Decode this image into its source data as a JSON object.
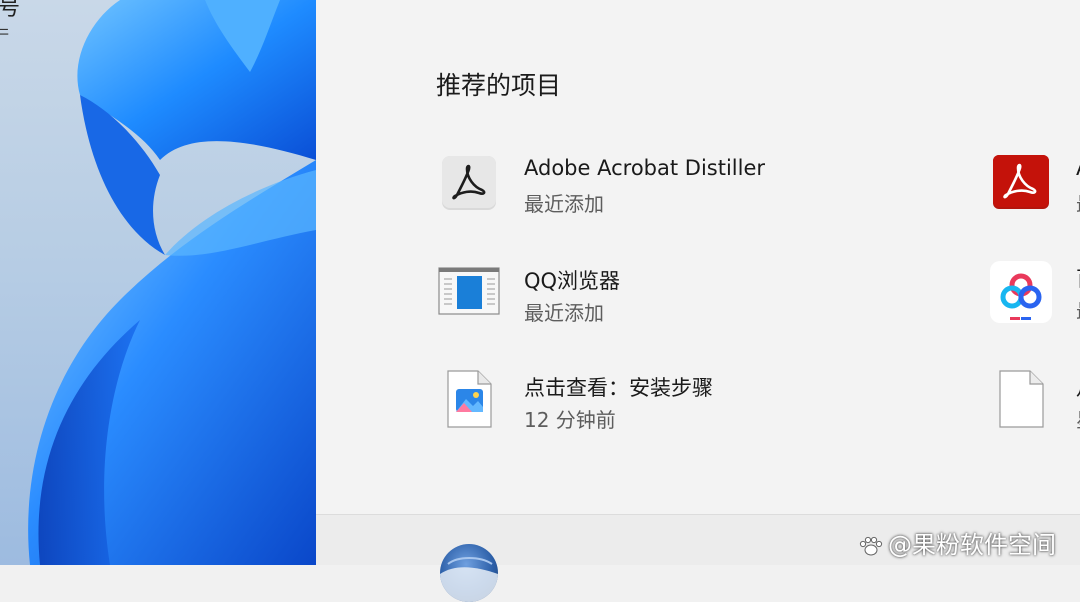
{
  "desktop": {
    "label_top": "号",
    "label_fragment": "ᄃ"
  },
  "start_menu": {
    "recommended_title": "推荐的项目",
    "items_left": [
      {
        "name": "Adobe Acrobat Distiller",
        "sub": "最近添加",
        "icon": "acrobat-distiller-icon"
      },
      {
        "name": "QQ浏览器",
        "sub": "最近添加",
        "icon": "qq-browser-icon"
      },
      {
        "name": "点击查看：安装步骤",
        "sub": "12 分钟前",
        "icon": "image-file-icon"
      }
    ],
    "items_right": [
      {
        "name": "A",
        "sub": "最",
        "icon": "adobe-acrobat-icon"
      },
      {
        "name": "百",
        "sub": "最",
        "icon": "baidu-netdisk-icon"
      },
      {
        "name": "月",
        "sub": "星",
        "icon": "blank-file-icon"
      }
    ]
  },
  "watermark": {
    "text": "@果粉软件空间"
  },
  "colors": {
    "panel_bg": "#f3f3f3",
    "acrobat_red": "#c4120a",
    "accent_blue": "#1677ff"
  }
}
